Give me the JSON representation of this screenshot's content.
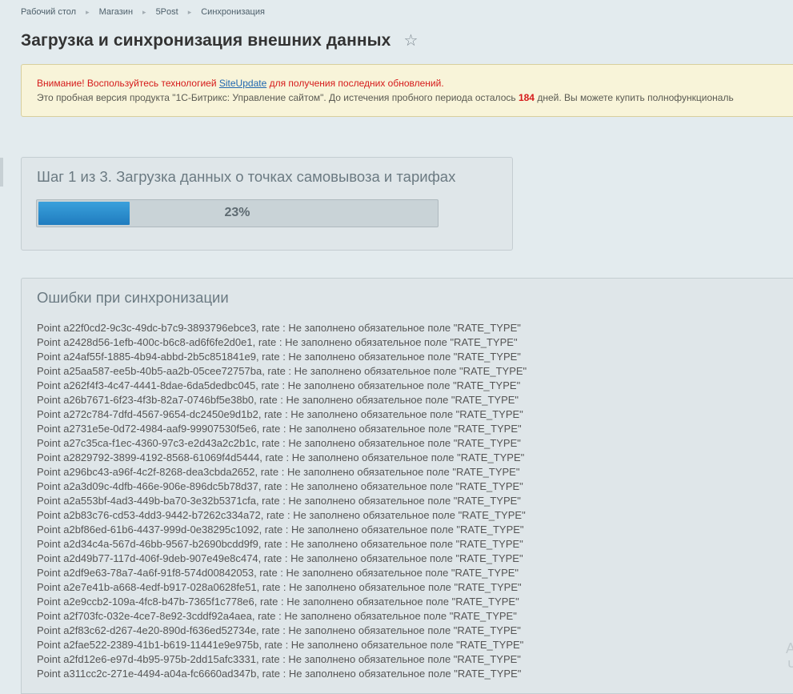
{
  "breadcrumb": [
    "Рабочий стол",
    "Магазин",
    "5Post",
    "Синхронизация"
  ],
  "page_title": "Загрузка и синхронизация внешних данных",
  "notice": {
    "warning_prefix": "Внимание! Воспользуйтесь технологией ",
    "warning_link": "SiteUpdate",
    "warning_suffix": " для получения последних обновлений.",
    "trial_prefix": "Это пробная версия продукта \"1С-Битрикс: Управление сайтом\". До истечения пробного периода осталось ",
    "trial_days": "184",
    "trial_suffix": " дней. Вы можете купить полнофункциональ"
  },
  "step": {
    "title": "Шаг 1 из 3. Загрузка данных о точках самовывоза и тарифах",
    "progress_percent": 23,
    "progress_label": "23%"
  },
  "errors": {
    "title": "Ошибки при синхронизации",
    "lines": [
      "Point a22f0cd2-9c3c-49dc-b7c9-3893796ebce3, rate : Не заполнено обязательное поле \"RATE_TYPE\"",
      "Point a2428d56-1efb-400c-b6c8-ad6f6fe2d0e1, rate : Не заполнено обязательное поле \"RATE_TYPE\"",
      "Point a24af55f-1885-4b94-abbd-2b5c851841e9, rate : Не заполнено обязательное поле \"RATE_TYPE\"",
      "Point a25aa587-ee5b-40b5-aa2b-05cee72757ba, rate : Не заполнено обязательное поле \"RATE_TYPE\"",
      "Point a262f4f3-4c47-4441-8dae-6da5dedbc045, rate : Не заполнено обязательное поле \"RATE_TYPE\"",
      "Point a26b7671-6f23-4f3b-82a7-0746bf5e38b0, rate : Не заполнено обязательное поле \"RATE_TYPE\"",
      "Point a272c784-7dfd-4567-9654-dc2450e9d1b2, rate : Не заполнено обязательное поле \"RATE_TYPE\"",
      "Point a2731e5e-0d72-4984-aaf9-99907530f5e6, rate : Не заполнено обязательное поле \"RATE_TYPE\"",
      "Point a27c35ca-f1ec-4360-97c3-e2d43a2c2b1c, rate : Не заполнено обязательное поле \"RATE_TYPE\"",
      "Point a2829792-3899-4192-8568-61069f4d5444, rate : Не заполнено обязательное поле \"RATE_TYPE\"",
      "Point a296bc43-a96f-4c2f-8268-dea3cbda2652, rate : Не заполнено обязательное поле \"RATE_TYPE\"",
      "Point a2a3d09c-4dfb-466e-906e-896dc5b78d37, rate : Не заполнено обязательное поле \"RATE_TYPE\"",
      "Point a2a553bf-4ad3-449b-ba70-3e32b5371cfa, rate : Не заполнено обязательное поле \"RATE_TYPE\"",
      "Point a2b83c76-cd53-4dd3-9442-b7262c334a72, rate : Не заполнено обязательное поле \"RATE_TYPE\"",
      "Point a2bf86ed-61b6-4437-999d-0e38295c1092, rate : Не заполнено обязательное поле \"RATE_TYPE\"",
      "Point a2d34c4a-567d-46bb-9567-b2690bcdd9f9, rate : Не заполнено обязательное поле \"RATE_TYPE\"",
      "Point a2d49b77-117d-406f-9deb-907e49e8c474, rate : Не заполнено обязательное поле \"RATE_TYPE\"",
      "Point a2df9e63-78a7-4a6f-91f8-574d00842053, rate : Не заполнено обязательное поле \"RATE_TYPE\"",
      "Point a2e7e41b-a668-4edf-b917-028a0628fe51, rate : Не заполнено обязательное поле \"RATE_TYPE\"",
      "Point a2e9ccb2-109a-4fc8-b47b-7365f1c778e6, rate : Не заполнено обязательное поле \"RATE_TYPE\"",
      "Point a2f703fc-032e-4ce7-8e92-3cddf92a4aea, rate : Не заполнено обязательное поле \"RATE_TYPE\"",
      "Point a2f83c62-d267-4e20-890d-f636ed52734e, rate : Не заполнено обязательное поле \"RATE_TYPE\"",
      "Point a2fae522-2389-41b1-b619-11441e9e975b, rate : Не заполнено обязательное поле \"RATE_TYPE\"",
      "Point a2fd12e6-e97d-4b95-975b-2dd15afc3331, rate : Не заполнено обязательное поле \"RATE_TYPE\"",
      "Point a311cc2c-271e-4494-a04a-fc6660ad347b, rate : Не заполнено обязательное поле \"RATE_TYPE\""
    ]
  },
  "edge_fragments": [
    "А",
    "Ч"
  ]
}
